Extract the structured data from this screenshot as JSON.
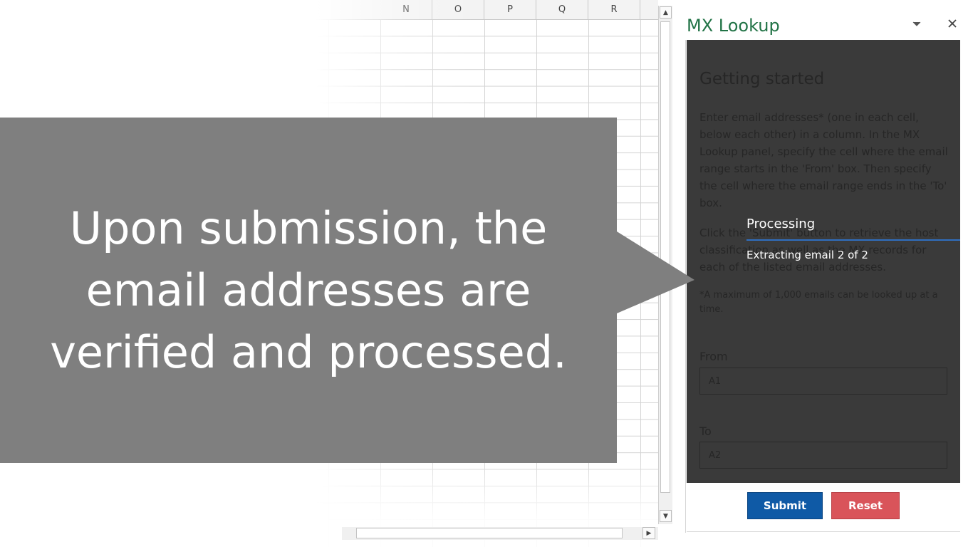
{
  "spreadsheet": {
    "column_headers": [
      "N",
      "O",
      "P",
      "Q",
      "R"
    ]
  },
  "callout": {
    "text": "Upon submission, the email addresses are verified and processed.",
    "fill_color": "#7f7f7f"
  },
  "task_pane": {
    "title": "MX Lookup",
    "dropdown_icon": "chevron-down-icon",
    "close_icon": "close-icon",
    "getting_started": {
      "heading": "Getting started",
      "paragraph1": "Enter email addresses* (one in each cell, below each other) in a column. In the MX Lookup panel, specify the cell where the email range starts in the 'From' box. Then specify the cell where the email range ends in the 'To' box.",
      "paragraph2": "Click the 'Submit' button to retrieve the host classification as well as the MX records for each of the listed email addresses.",
      "note": "*A maximum of 1,000 emails can be looked up at a time."
    },
    "from": {
      "label": "From",
      "value": "A1"
    },
    "to": {
      "label": "To",
      "value": "A2"
    },
    "processing": {
      "title": "Processing",
      "status": "Extracting email 2 of 2"
    },
    "buttons": {
      "submit": "Submit",
      "reset": "Reset"
    },
    "colors": {
      "title": "#217346",
      "submit": "#0f5aa6",
      "reset": "#d9545a",
      "overlay": "#3a3a3a"
    }
  }
}
